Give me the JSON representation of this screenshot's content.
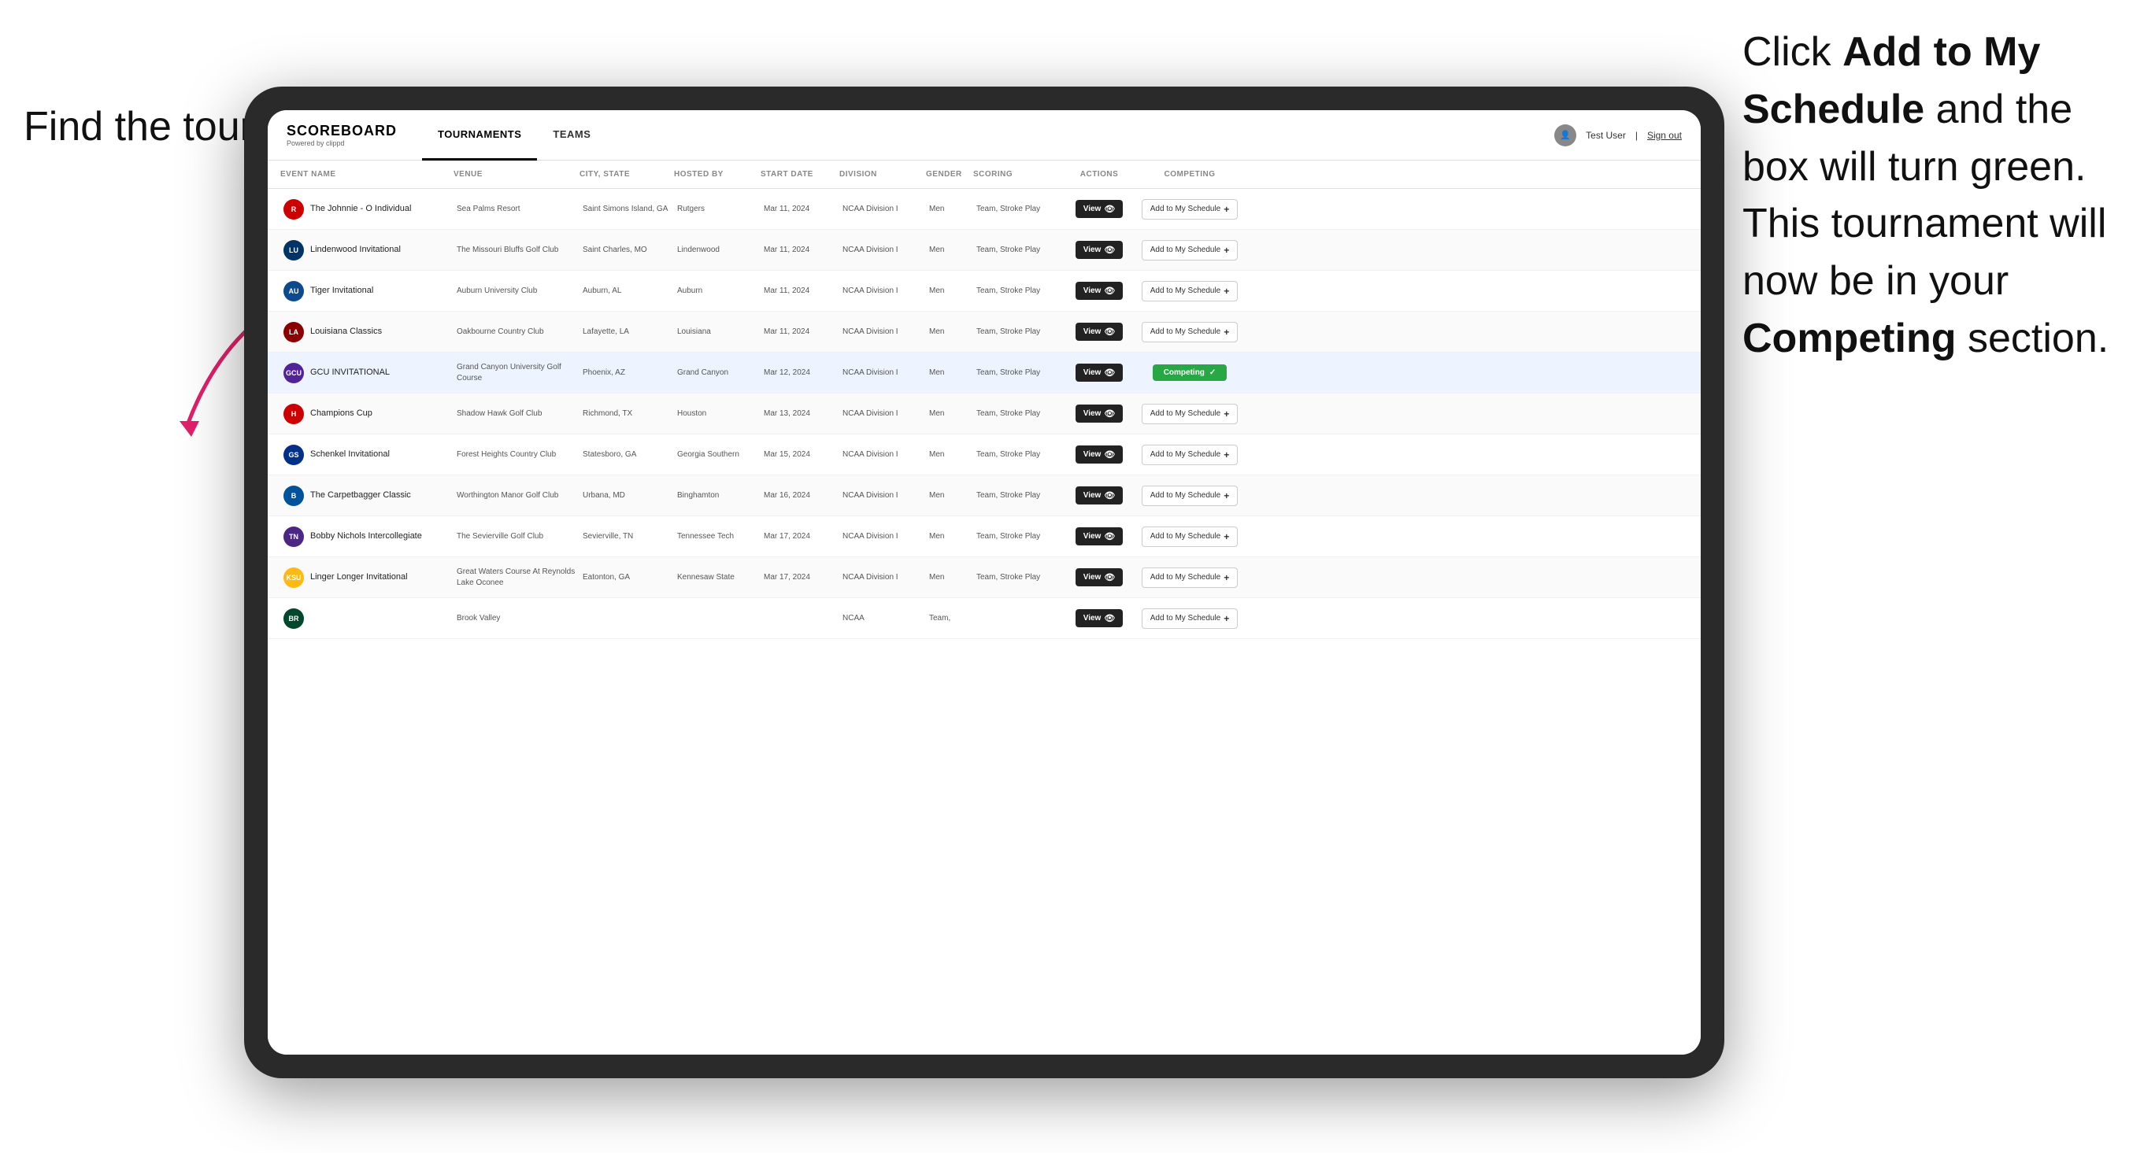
{
  "annotations": {
    "left": "Find the\ntournament.",
    "right_line1": "Click ",
    "right_bold1": "Add to My\nSchedule",
    "right_line2": " and the\nbox will turn green.\nThis tournament\nwill now be in\nyour ",
    "right_bold2": "Competing",
    "right_line3": "\nsection."
  },
  "header": {
    "logo": "SCOREBOARD",
    "logo_sub": "Powered by clippd",
    "tabs": [
      "TOURNAMENTS",
      "TEAMS"
    ],
    "active_tab": "TOURNAMENTS",
    "user": "Test User",
    "sign_out": "Sign out"
  },
  "table": {
    "columns": [
      "EVENT NAME",
      "VENUE",
      "CITY, STATE",
      "HOSTED BY",
      "START DATE",
      "DIVISION",
      "GENDER",
      "SCORING",
      "ACTIONS",
      "COMPETING"
    ],
    "rows": [
      {
        "logo_color": "r",
        "logo_text": "R",
        "event": "The Johnnie - O Individual",
        "venue": "Sea Palms Resort",
        "city_state": "Saint Simons Island, GA",
        "hosted_by": "Rutgers",
        "start_date": "Mar 11, 2024",
        "division": "NCAA Division I",
        "gender": "Men",
        "scoring": "Team, Stroke Play",
        "status": "add",
        "highlighted": false
      },
      {
        "logo_color": "l",
        "logo_text": "LU",
        "event": "Lindenwood Invitational",
        "venue": "The Missouri Bluffs Golf Club",
        "city_state": "Saint Charles, MO",
        "hosted_by": "Lindenwood",
        "start_date": "Mar 11, 2024",
        "division": "NCAA Division I",
        "gender": "Men",
        "scoring": "Team, Stroke Play",
        "status": "add",
        "highlighted": false
      },
      {
        "logo_color": "au",
        "logo_text": "AU",
        "event": "Tiger Invitational",
        "venue": "Auburn University Club",
        "city_state": "Auburn, AL",
        "hosted_by": "Auburn",
        "start_date": "Mar 11, 2024",
        "division": "NCAA Division I",
        "gender": "Men",
        "scoring": "Team, Stroke Play",
        "status": "add",
        "highlighted": false
      },
      {
        "logo_color": "la",
        "logo_text": "LA",
        "event": "Louisiana Classics",
        "venue": "Oakbourne Country Club",
        "city_state": "Lafayette, LA",
        "hosted_by": "Louisiana",
        "start_date": "Mar 11, 2024",
        "division": "NCAA Division I",
        "gender": "Men",
        "scoring": "Team, Stroke Play",
        "status": "add",
        "highlighted": false
      },
      {
        "logo_color": "gcu",
        "logo_text": "GCU",
        "event": "GCU INVITATIONAL",
        "venue": "Grand Canyon University Golf Course",
        "city_state": "Phoenix, AZ",
        "hosted_by": "Grand Canyon",
        "start_date": "Mar 12, 2024",
        "division": "NCAA Division I",
        "gender": "Men",
        "scoring": "Team, Stroke Play",
        "status": "competing",
        "highlighted": true
      },
      {
        "logo_color": "h",
        "logo_text": "H",
        "event": "Champions Cup",
        "venue": "Shadow Hawk Golf Club",
        "city_state": "Richmond, TX",
        "hosted_by": "Houston",
        "start_date": "Mar 13, 2024",
        "division": "NCAA Division I",
        "gender": "Men",
        "scoring": "Team, Stroke Play",
        "status": "add",
        "highlighted": false
      },
      {
        "logo_color": "gs",
        "logo_text": "GS",
        "event": "Schenkel Invitational",
        "venue": "Forest Heights Country Club",
        "city_state": "Statesboro, GA",
        "hosted_by": "Georgia Southern",
        "start_date": "Mar 15, 2024",
        "division": "NCAA Division I",
        "gender": "Men",
        "scoring": "Team, Stroke Play",
        "status": "add",
        "highlighted": false
      },
      {
        "logo_color": "b",
        "logo_text": "B",
        "event": "The Carpetbagger Classic",
        "venue": "Worthington Manor Golf Club",
        "city_state": "Urbana, MD",
        "hosted_by": "Binghamton",
        "start_date": "Mar 16, 2024",
        "division": "NCAA Division I",
        "gender": "Men",
        "scoring": "Team, Stroke Play",
        "status": "add",
        "highlighted": false
      },
      {
        "logo_color": "tn",
        "logo_text": "TN",
        "event": "Bobby Nichols Intercollegiate",
        "venue": "The Sevierville Golf Club",
        "city_state": "Sevierville, TN",
        "hosted_by": "Tennessee Tech",
        "start_date": "Mar 17, 2024",
        "division": "NCAA Division I",
        "gender": "Men",
        "scoring": "Team, Stroke Play",
        "status": "add",
        "highlighted": false
      },
      {
        "logo_color": "k",
        "logo_text": "KSU",
        "event": "Linger Longer Invitational",
        "venue": "Great Waters Course At Reynolds Lake Oconee",
        "city_state": "Eatonton, GA",
        "hosted_by": "Kennesaw State",
        "start_date": "Mar 17, 2024",
        "division": "NCAA Division I",
        "gender": "Men",
        "scoring": "Team, Stroke Play",
        "status": "add",
        "highlighted": false
      },
      {
        "logo_color": "br",
        "logo_text": "BR",
        "event": "",
        "venue": "Brook Valley",
        "city_state": "",
        "hosted_by": "",
        "start_date": "",
        "division": "NCAA",
        "gender": "Team,",
        "scoring": "",
        "status": "add",
        "highlighted": false
      }
    ],
    "view_label": "View",
    "add_label": "Add to My Schedule",
    "competing_label": "Competing"
  }
}
